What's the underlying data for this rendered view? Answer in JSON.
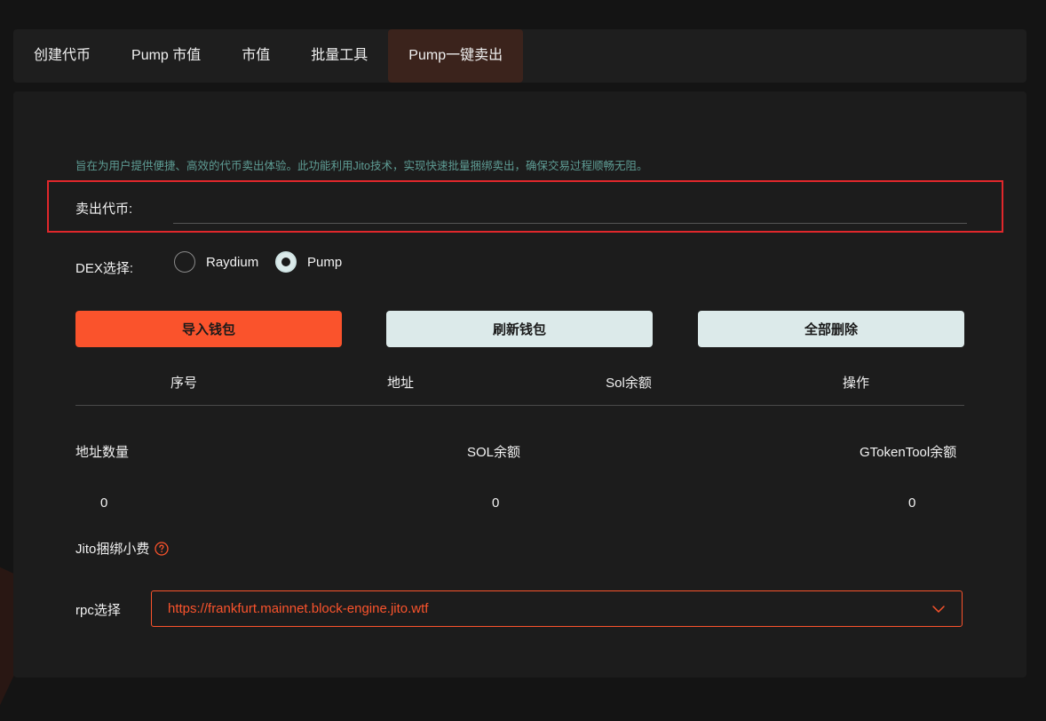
{
  "tabs": [
    {
      "label": "创建代币",
      "active": false
    },
    {
      "label": "Pump 市值",
      "active": false
    },
    {
      "label": "市值",
      "active": false
    },
    {
      "label": "批量工具",
      "active": false
    },
    {
      "label": "Pump一键卖出",
      "active": true
    }
  ],
  "intro_text": "旨在为用户提供便捷、高效的代币卖出体验。此功能利用Jito技术，实现快速批量捆绑卖出，确保交易过程顺畅无阻。",
  "sell_token": {
    "label": "卖出代币:",
    "value": "",
    "placeholder": ""
  },
  "dex": {
    "label": "DEX选择:",
    "options": [
      {
        "label": "Raydium",
        "checked": false
      },
      {
        "label": "Pump",
        "checked": true
      }
    ]
  },
  "buttons": {
    "import_wallet": "导入钱包",
    "refresh_wallet": "刷新钱包",
    "delete_all": "全部删除"
  },
  "table": {
    "headers": [
      "序号",
      "地址",
      "Sol余额",
      "操作"
    ]
  },
  "stats": [
    {
      "label": "地址数量",
      "value": "0"
    },
    {
      "label": "SOL余额",
      "value": "0"
    },
    {
      "label": "GTokenTool余额",
      "value": "0"
    }
  ],
  "jito": {
    "label": "Jito捆绑小费",
    "icon": "question-circle-icon"
  },
  "rpc": {
    "label": "rpc选择",
    "value": "https://frankfurt.mainnet.block-engine.jito.wtf"
  },
  "colors": {
    "accent": "#fa532c",
    "highlight_border": "#e0272b",
    "light_button": "#dceaea",
    "intro_text": "#5e9c94",
    "active_tab": "#3b231c"
  }
}
